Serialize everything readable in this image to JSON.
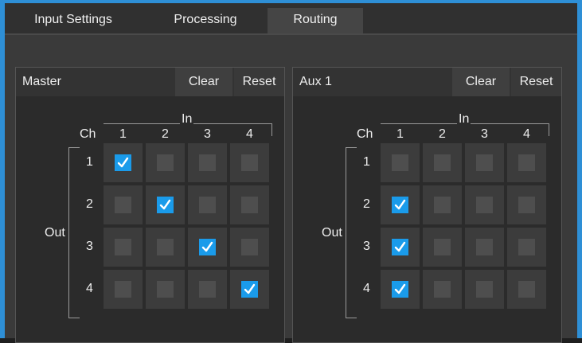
{
  "tabs": [
    {
      "label": "Input Settings",
      "active": false
    },
    {
      "label": "Processing",
      "active": false
    },
    {
      "label": "Routing",
      "active": true
    }
  ],
  "colors": {
    "accent": "#1a9bea",
    "border": "#2e8fd6"
  },
  "labels": {
    "ch": "Ch",
    "in": "In",
    "out": "Out"
  },
  "panels": [
    {
      "title": "Master",
      "clear_label": "Clear",
      "reset_label": "Reset",
      "in_channels": [
        "1",
        "2",
        "3",
        "4"
      ],
      "out_channels": [
        "1",
        "2",
        "3",
        "4"
      ],
      "matrix": [
        [
          true,
          false,
          false,
          false
        ],
        [
          false,
          true,
          false,
          false
        ],
        [
          false,
          false,
          true,
          false
        ],
        [
          false,
          false,
          false,
          true
        ]
      ]
    },
    {
      "title": "Aux 1",
      "clear_label": "Clear",
      "reset_label": "Reset",
      "in_channels": [
        "1",
        "2",
        "3",
        "4"
      ],
      "out_channels": [
        "1",
        "2",
        "3",
        "4"
      ],
      "matrix": [
        [
          false,
          false,
          false,
          false
        ],
        [
          true,
          false,
          false,
          false
        ],
        [
          true,
          false,
          false,
          false
        ],
        [
          true,
          false,
          false,
          false
        ]
      ]
    }
  ]
}
